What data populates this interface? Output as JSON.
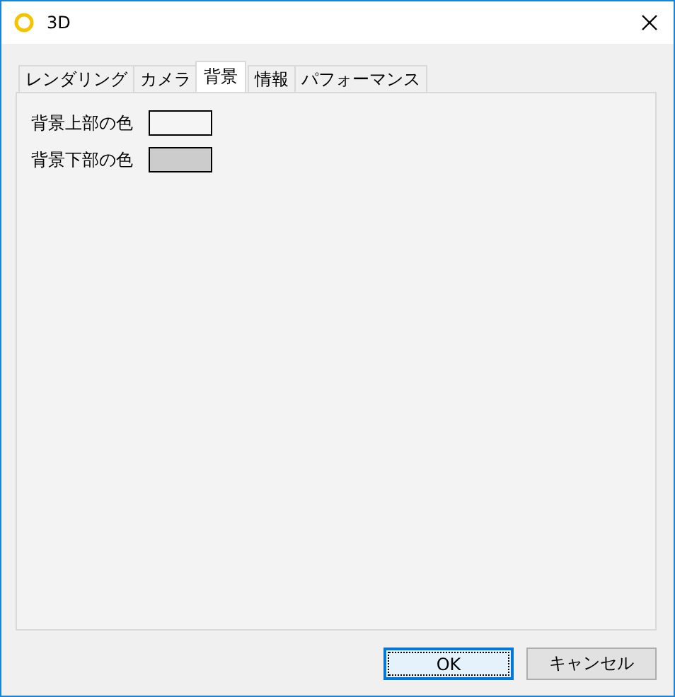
{
  "window": {
    "title": "3D"
  },
  "tabs": [
    {
      "label": "レンダリング",
      "selected": false
    },
    {
      "label": "カメラ",
      "selected": false
    },
    {
      "label": "背景",
      "selected": true
    },
    {
      "label": "情報",
      "selected": false
    },
    {
      "label": "パフォーマンス",
      "selected": false
    }
  ],
  "color_settings": [
    {
      "label": "背景上部の色",
      "color": "#f5f5f5"
    },
    {
      "label": "背景下部の色",
      "color": "#cccccc"
    }
  ],
  "buttons": [
    {
      "label": "OK",
      "selected": true
    },
    {
      "label": "キャンセル",
      "selected": false
    }
  ]
}
